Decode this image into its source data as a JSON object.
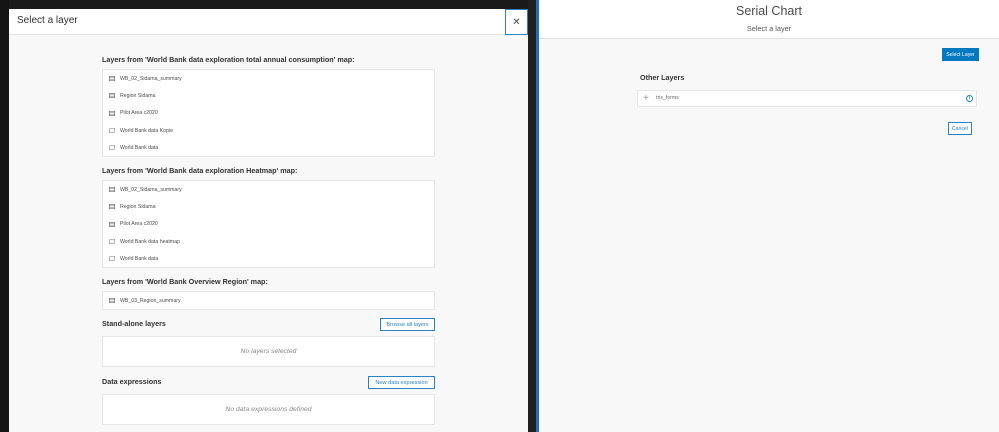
{
  "modal": {
    "title": "Select a layer",
    "close_icon": "close-icon"
  },
  "groups": [
    {
      "title": "Layers from 'World Bank data exploration total annual consumption' map:",
      "items": [
        {
          "label": "WB_02_Sidama_summary",
          "icon": "table-icon"
        },
        {
          "label": "Region Sidama",
          "icon": "table-icon"
        },
        {
          "label": "Pilot Area c2020",
          "icon": "table-icon"
        },
        {
          "label": "World Bank data Kopie",
          "icon": "map-layer-icon"
        },
        {
          "label": "World Bank data",
          "icon": "map-layer-icon"
        }
      ]
    },
    {
      "title": "Layers from 'World Bank data exploration Heatmap' map:",
      "items": [
        {
          "label": "WB_02_Sidama_summary",
          "icon": "table-icon"
        },
        {
          "label": "Region Sidama",
          "icon": "table-icon"
        },
        {
          "label": "Pilot Area c2020",
          "icon": "table-icon"
        },
        {
          "label": "World Bank data heatmap",
          "icon": "map-layer-icon"
        },
        {
          "label": "World Bank data",
          "icon": "map-layer-icon"
        }
      ]
    },
    {
      "title": "Layers from 'World Bank Overview Region' map:",
      "items": [
        {
          "label": "WB_03_Region_summary",
          "icon": "table-icon"
        }
      ]
    }
  ],
  "standalone": {
    "title": "Stand-alone layers",
    "browse_label": "Browse all layers",
    "empty_text": "No layers selected"
  },
  "expressions": {
    "title": "Data expressions",
    "new_label": "New data expression",
    "empty_text": "No data expressions defined"
  },
  "right_panel": {
    "title": "Serial Chart",
    "subtitle": "Select a layer",
    "select_layer_label": "Select Layer",
    "other_layers_title": "Other Layers",
    "other_layers": [
      {
        "label": "tris_forms",
        "icon": "plus-icon"
      }
    ],
    "info_icon": "info-icon",
    "cancel_label": "Cancel"
  },
  "colors": {
    "accent": "#0079c1",
    "outline": "#2a83c6",
    "background": "#f8f8f8"
  }
}
